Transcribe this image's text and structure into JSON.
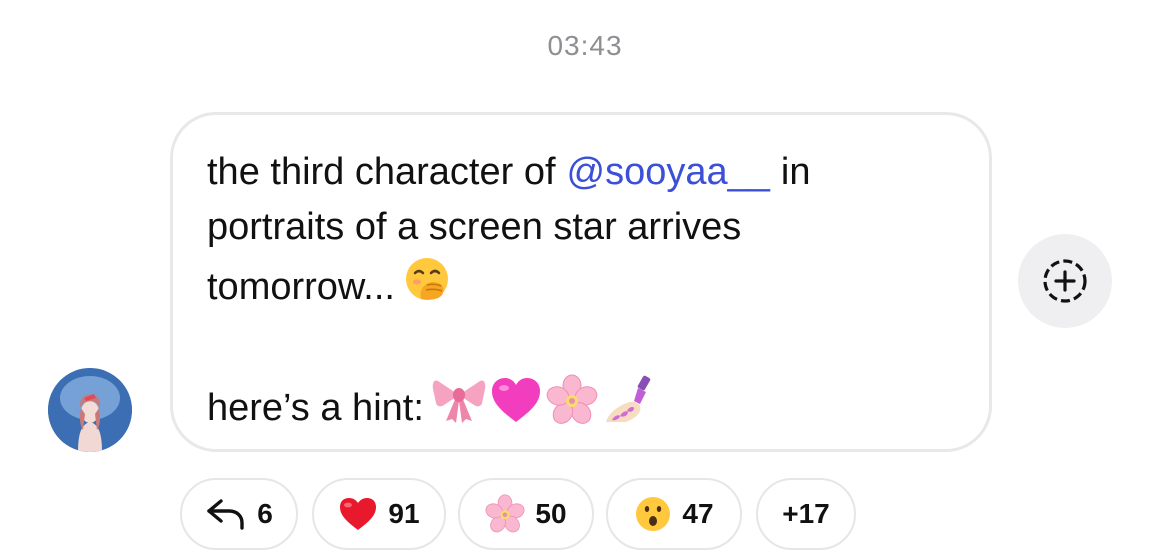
{
  "timestamp": "03:43",
  "message": {
    "line1_before": "the third character of",
    "mention": "@sooyaa__",
    "line1_after": "in",
    "line2": "portraits of a screen star arrives",
    "line3": "tomorrow...",
    "line5": "here’s a hint:",
    "emojis": [
      "face-with-hand-over-mouth",
      "ribbon",
      "pink-heart",
      "cherry-blossom",
      "nail-polish"
    ]
  },
  "reactions": [
    {
      "icon": "reply-arrow-icon",
      "count": "6"
    },
    {
      "icon": "red-heart",
      "count": "91"
    },
    {
      "icon": "cherry-blossom",
      "count": "50"
    },
    {
      "icon": "surprised-face",
      "count": "47"
    },
    {
      "icon": "",
      "count": "+17"
    }
  ],
  "colors": {
    "mention": "#3b4fd8",
    "bubble_border": "#e8e8ea",
    "timestamp": "#8e8e93",
    "share_button_bg": "#efeff1"
  }
}
